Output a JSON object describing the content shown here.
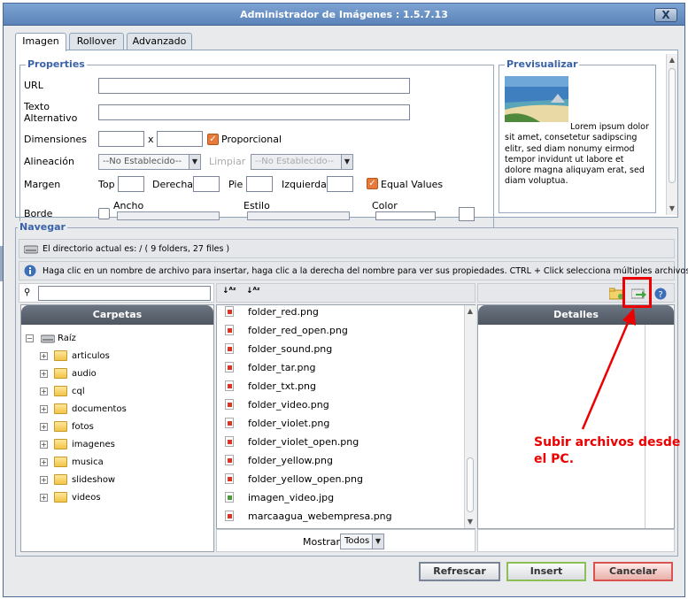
{
  "window": {
    "title": "Administrador de Imágenes : 1.5.7.13",
    "close_label": "X"
  },
  "tabs": [
    {
      "label": "Imagen",
      "active": true
    },
    {
      "label": "Rollover",
      "active": false
    },
    {
      "label": "Advanzado",
      "active": false
    }
  ],
  "properties": {
    "legend": "Properties",
    "url_label": "URL",
    "url_value": "",
    "alt_label_1": "Texto",
    "alt_label_2": "Alternativo",
    "alt_value": "",
    "dim_label": "Dimensiones",
    "dim_sep": "x",
    "proportional_label": "Proporcional",
    "proportional_checked": true,
    "align_label": "Alineación",
    "align_value": "--No Establecido--",
    "clear_label": "Limpiar",
    "clear_value": "--No Establecido--",
    "margin_label": "Margen",
    "margin_top": "Top",
    "margin_right": "Derecha",
    "margin_bottom": "Pie",
    "margin_left": "Izquierda",
    "equal_values_label": "Equal Values",
    "equal_values_checked": true,
    "border_label": "Borde",
    "border_width_label": "Ancho",
    "border_style_label": "Estilo",
    "border_color_label": "Color"
  },
  "preview": {
    "legend": "Previsualizar",
    "text": "Lorem ipsum dolor sit amet, consetetur sadipscing elitr, sed diam nonumy eirmod tempor invidunt ut labore et dolore magna aliquyam erat, sed diam voluptua."
  },
  "navigate": {
    "legend": "Navegar",
    "current_dir": "El directorio actual es: / ( 9 folders, 27 files )",
    "info": "Haga clic en un nombre de archivo para insertar, haga clic a la derecha del nombre para ver sus propiedades. CTRL + Click selecciona múltiples archivos.",
    "filter_value": "",
    "folders_header": "Carpetas",
    "details_header": "Detalles",
    "root_label": "Raíz",
    "folders": [
      "articulos",
      "audio",
      "cql",
      "documentos",
      "fotos",
      "imagenes",
      "musica",
      "slideshow",
      "videos"
    ],
    "files": [
      {
        "name": "folder_red.png",
        "type": "png"
      },
      {
        "name": "folder_red_open.png",
        "type": "png"
      },
      {
        "name": "folder_sound.png",
        "type": "png"
      },
      {
        "name": "folder_tar.png",
        "type": "png"
      },
      {
        "name": "folder_txt.png",
        "type": "png"
      },
      {
        "name": "folder_video.png",
        "type": "png"
      },
      {
        "name": "folder_violet.png",
        "type": "png"
      },
      {
        "name": "folder_violet_open.png",
        "type": "png"
      },
      {
        "name": "folder_yellow.png",
        "type": "png"
      },
      {
        "name": "folder_yellow_open.png",
        "type": "png"
      },
      {
        "name": "imagen_video.jpg",
        "type": "jpg"
      },
      {
        "name": "marcaagua_webempresa.png",
        "type": "png"
      }
    ],
    "show_label": "Mostrar",
    "show_value": "Todos"
  },
  "buttons": {
    "refresh": "Refrescar",
    "insert": "Insert",
    "cancel": "Cancelar"
  },
  "annotation": {
    "line1": "Subir archivos desde",
    "line2": "el PC."
  },
  "colors": {
    "accent": "#3a62a8",
    "annotation": "#ec0000",
    "title_bar": "#6b93c6"
  }
}
